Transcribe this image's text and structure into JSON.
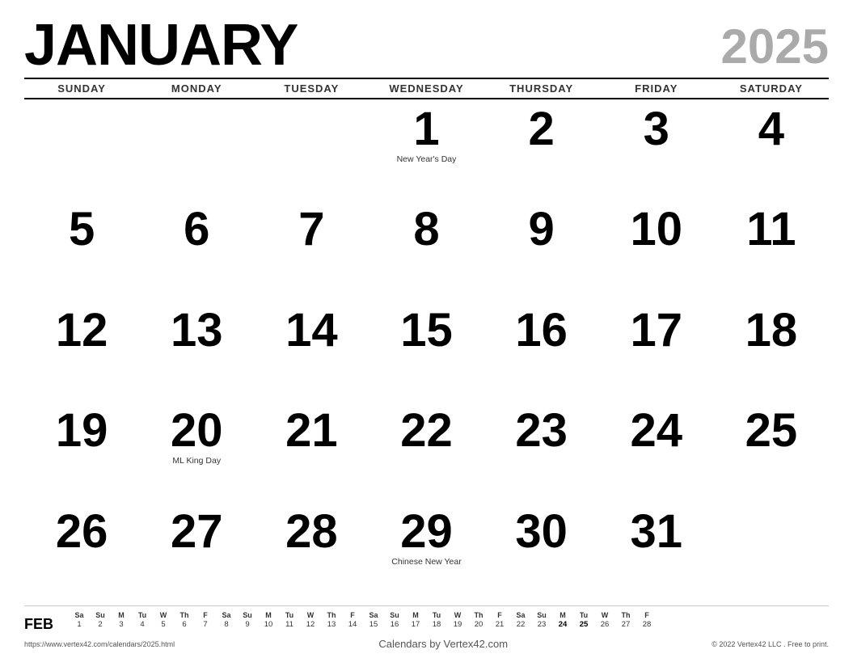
{
  "header": {
    "month": "JANUARY",
    "year": "2025"
  },
  "days_of_week": [
    "SUNDAY",
    "MONDAY",
    "TUESDAY",
    "WEDNESDAY",
    "THURSDAY",
    "FRIDAY",
    "SATURDAY"
  ],
  "weeks": [
    [
      {
        "day": "",
        "holiday": ""
      },
      {
        "day": "",
        "holiday": ""
      },
      {
        "day": "",
        "holiday": ""
      },
      {
        "day": "1",
        "holiday": "New Year's Day"
      },
      {
        "day": "2",
        "holiday": ""
      },
      {
        "day": "3",
        "holiday": ""
      },
      {
        "day": "4",
        "holiday": ""
      }
    ],
    [
      {
        "day": "5",
        "holiday": ""
      },
      {
        "day": "6",
        "holiday": ""
      },
      {
        "day": "7",
        "holiday": ""
      },
      {
        "day": "8",
        "holiday": ""
      },
      {
        "day": "9",
        "holiday": ""
      },
      {
        "day": "10",
        "holiday": ""
      },
      {
        "day": "11",
        "holiday": ""
      }
    ],
    [
      {
        "day": "12",
        "holiday": ""
      },
      {
        "day": "13",
        "holiday": ""
      },
      {
        "day": "14",
        "holiday": ""
      },
      {
        "day": "15",
        "holiday": ""
      },
      {
        "day": "16",
        "holiday": ""
      },
      {
        "day": "17",
        "holiday": ""
      },
      {
        "day": "18",
        "holiday": ""
      }
    ],
    [
      {
        "day": "19",
        "holiday": ""
      },
      {
        "day": "20",
        "holiday": "ML King Day"
      },
      {
        "day": "21",
        "holiday": ""
      },
      {
        "day": "22",
        "holiday": ""
      },
      {
        "day": "23",
        "holiday": ""
      },
      {
        "day": "24",
        "holiday": ""
      },
      {
        "day": "25",
        "holiday": ""
      }
    ],
    [
      {
        "day": "26",
        "holiday": ""
      },
      {
        "day": "27",
        "holiday": ""
      },
      {
        "day": "28",
        "holiday": ""
      },
      {
        "day": "29",
        "holiday": "Chinese New Year"
      },
      {
        "day": "30",
        "holiday": ""
      },
      {
        "day": "31",
        "holiday": ""
      },
      {
        "day": "",
        "holiday": ""
      }
    ]
  ],
  "mini_months": [
    {
      "label": "FEB",
      "day_labels": [
        "Sa",
        "Su",
        "M",
        "Tu",
        "W",
        "Th",
        "F",
        "Sa",
        "Su",
        "M",
        "Tu",
        "W",
        "Th",
        "F",
        "Sa",
        "Su",
        "M",
        "Tu",
        "Th",
        "F",
        "Sa",
        "Su",
        "M",
        "Tu",
        "W",
        "Th",
        "F"
      ],
      "dates": [
        "1",
        "2",
        "3",
        "4",
        "5",
        "6",
        "7",
        "8",
        "9",
        "10",
        "11",
        "12",
        "13",
        "14",
        "15",
        "16",
        "17",
        "18",
        "19",
        "20",
        "21",
        "22",
        "23",
        "24",
        "25",
        "26",
        "27",
        "28"
      ],
      "bold_dates": [
        "24",
        "25"
      ]
    }
  ],
  "footer": {
    "url": "https://www.vertex42.com/calendars/2025.html",
    "brand": "Calendars by Vertex42.com",
    "copyright": "© 2022 Vertex42 LLC . Free to print."
  }
}
